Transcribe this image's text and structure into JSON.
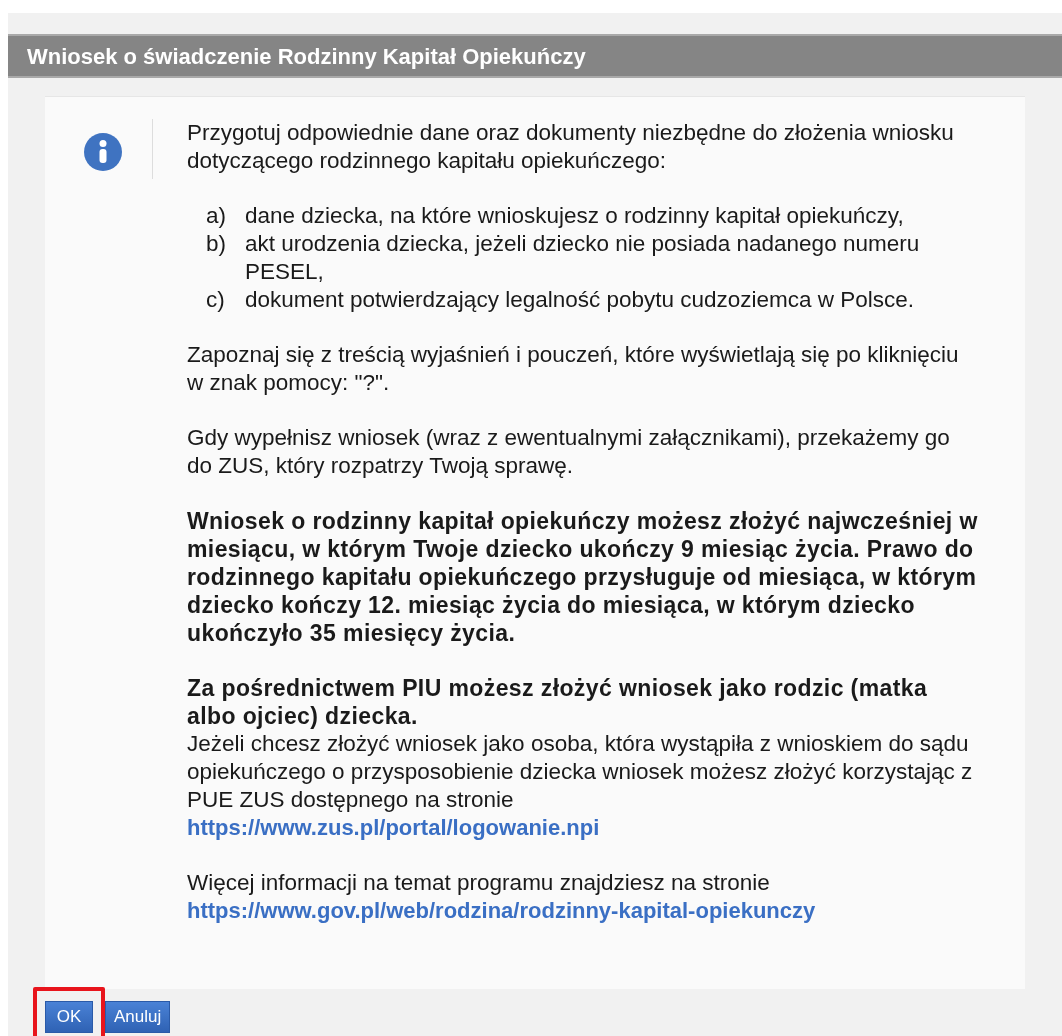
{
  "window": {
    "title": "Wniosek o świadczenie Rodzinny Kapitał Opiekuńczy"
  },
  "message": {
    "intro": "Przygotuj odpowiednie dane oraz dokumenty niezbędne do złożenia wniosku dotyczącego rodzinnego kapitału opiekuńczego:",
    "items": [
      {
        "marker": "a)",
        "text": "dane dziecka, na które wnioskujesz o rodzinny kapitał opiekuńczy,"
      },
      {
        "marker": "b)",
        "text": "akt urodzenia dziecka, jeżeli dziecko nie posiada nadanego numeru PESEL,"
      },
      {
        "marker": "c)",
        "text": "dokument potwierdzający legalność pobytu cudzoziemca w Polsce."
      }
    ],
    "blocks": [
      {
        "lines": [
          {
            "kind": "text",
            "text": "Zapoznaj się z treścią wyjaśnień i pouczeń, które wyświetlają się po kliknięciu w znak pomocy: \"?\"."
          }
        ]
      },
      {
        "lines": [
          {
            "kind": "text",
            "text": "Gdy wypełnisz wniosek (wraz z ewentualnymi załącznikami), przekażemy go do ZUS, który rozpatrzy Twoją sprawę."
          }
        ]
      },
      {
        "lines": [
          {
            "kind": "bold",
            "text": "Wniosek o rodzinny kapitał opiekuńczy możesz złożyć najwcześniej w miesiącu, w którym Twoje dziecko ukończy 9 miesiąc życia. Prawo do rodzinnego kapitału opiekuńczego przysługuje od miesiąca, w którym dziecko kończy 12. miesiąc życia do miesiąca, w którym dziecko ukończyło 35 miesięcy życia."
          }
        ]
      },
      {
        "lines": [
          {
            "kind": "bold",
            "text": "Za pośrednictwem PIU możesz złożyć wniosek jako rodzic (matka albo ojciec) dziecka."
          },
          {
            "kind": "text",
            "text": "Jeżeli chcesz złożyć wniosek jako osoba, która wystąpiła z wnioskiem do sądu opiekuńczego o przysposobienie dziecka wniosek możesz złożyć korzystając z PUE ZUS dostępnego na stronie"
          },
          {
            "kind": "link",
            "text": "https://www.zus.pl/portal/logowanie.npi"
          }
        ]
      },
      {
        "lines": [
          {
            "kind": "text",
            "text": "Więcej informacji na temat programu znajdziesz na stronie"
          },
          {
            "kind": "link",
            "text": "https://www.gov.pl/web/rodzina/rodzinny-kapital-opiekunczy"
          }
        ]
      }
    ]
  },
  "buttons": [
    {
      "label": "OK",
      "highlighted": true
    },
    {
      "label": "Anuluj",
      "highlighted": false
    }
  ]
}
